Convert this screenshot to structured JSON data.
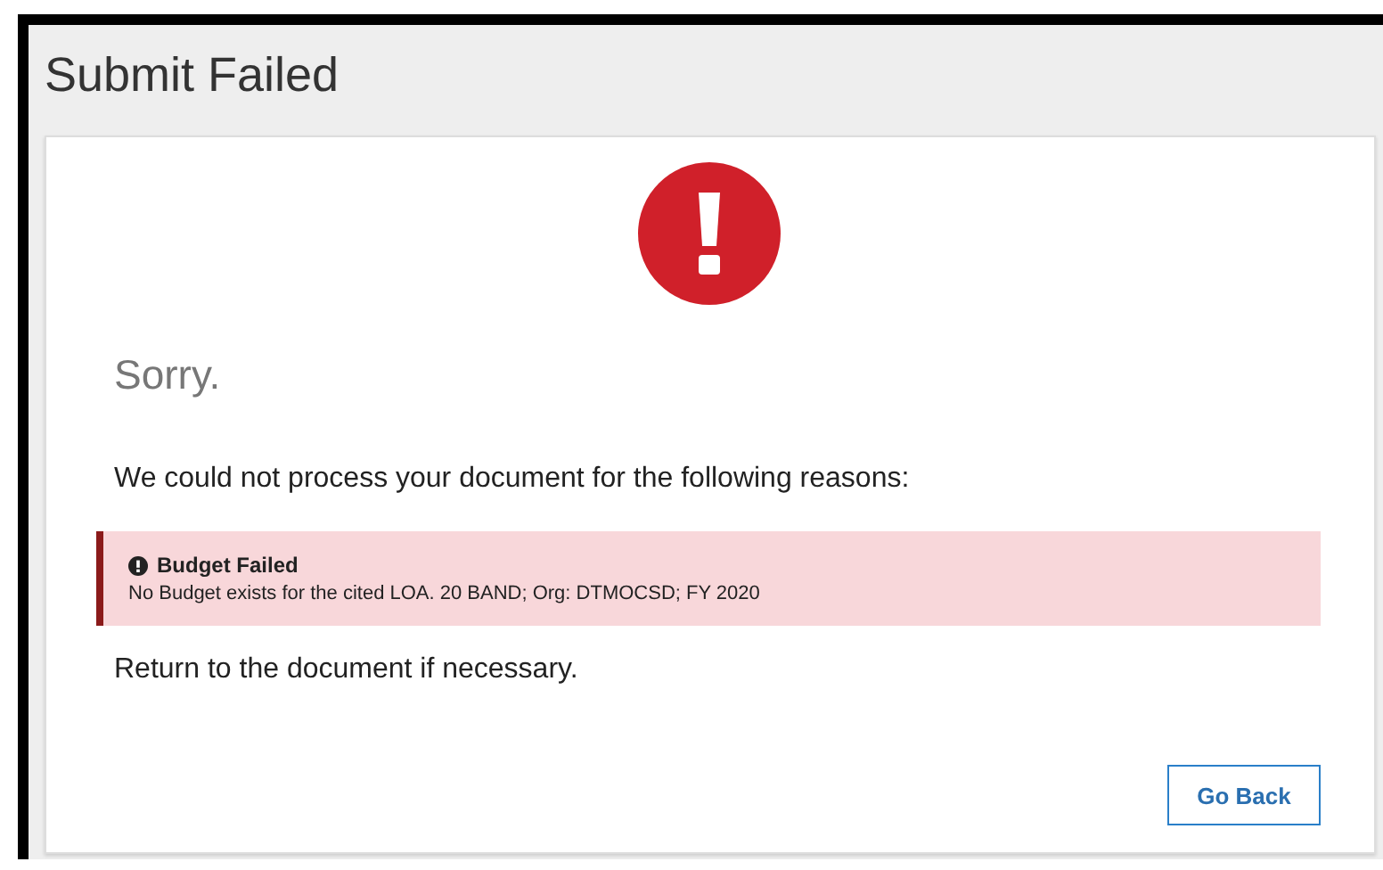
{
  "window": {
    "title": "Submit Failed"
  },
  "card": {
    "heading": "Sorry.",
    "message": "We could not process your document for the following reasons:",
    "errors": [
      {
        "title": "Budget Failed",
        "detail": "No Budget exists for the cited LOA. 20 BAND; Org: DTMOCSD; FY 2020"
      }
    ],
    "footer": "Return to the document if necessary.",
    "buttons": [
      "Go Back"
    ]
  }
}
